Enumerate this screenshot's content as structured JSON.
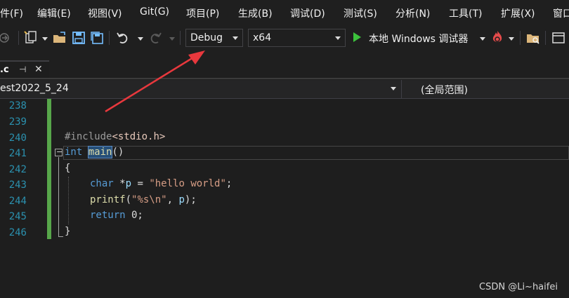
{
  "menu": {
    "items": [
      "件(F)",
      "编辑(E)",
      "视图(V)",
      "Git(G)",
      "项目(P)",
      "生成(B)",
      "调试(D)",
      "测试(S)",
      "分析(N)",
      "工具(T)",
      "扩展(X)",
      "窗口"
    ]
  },
  "toolbar": {
    "config_value": "Debug",
    "platform_value": "x64",
    "debugger_label": "本地 Windows 调试器"
  },
  "tab": {
    "label": ".c",
    "pin_glyph": "⊣",
    "close_glyph": "✕"
  },
  "navbar": {
    "project": "est2022_5_24",
    "scope": "(全局范围)"
  },
  "editor": {
    "line_numbers": [
      "238",
      "239",
      "240",
      "241",
      "242",
      "243",
      "244",
      "245",
      "246"
    ],
    "code": {
      "l240_a": "#include",
      "l240_b": "<stdio.h>",
      "l241_kw": "int",
      "l241_fn": "main",
      "l241_rest": "()",
      "l242": "{",
      "l243_kw": "char",
      "l243_a": " *",
      "l243_var": "p",
      "l243_b": " = ",
      "l243_str": "\"hello world\"",
      "l243_c": ";",
      "l244_fn": "printf",
      "l244_a": "(",
      "l244_str": "\"%s\\n\"",
      "l244_b": ", ",
      "l244_var": "p",
      "l244_c": ");",
      "l245_kw": "return",
      "l245_a": " 0;",
      "l246": "}",
      "collapse_glyph": "−"
    }
  },
  "watermark": "CSDN @Li~haifei",
  "colors": {
    "annotation_arrow": "#e8383d",
    "change_bar": "#57a64a",
    "run_green": "#3cc23c"
  }
}
